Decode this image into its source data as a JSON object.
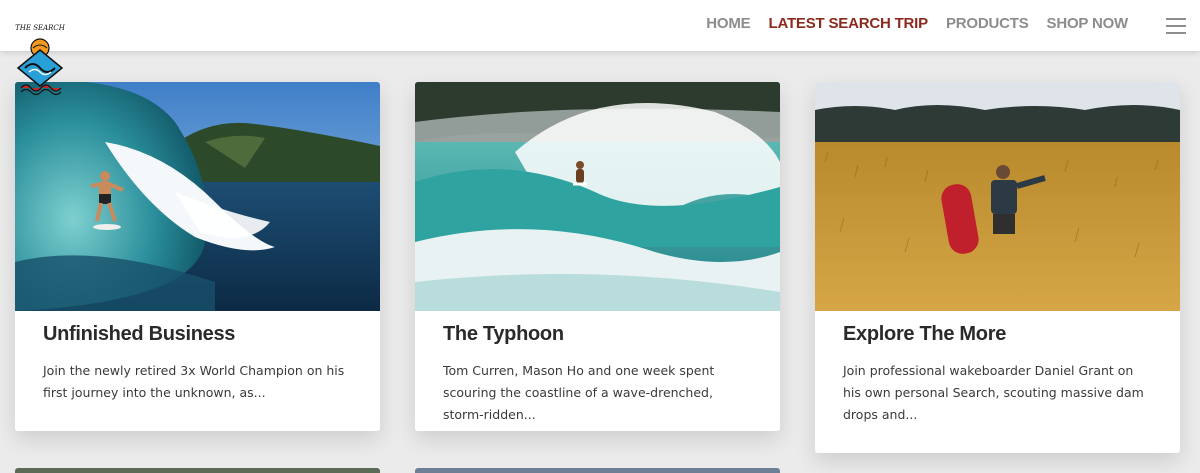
{
  "header": {
    "nav": [
      {
        "label": "HOME",
        "active": false
      },
      {
        "label": "LATEST SEARCH TRIP",
        "active": true
      },
      {
        "label": "PRODUCTS",
        "active": false
      },
      {
        "label": "SHOP NOW",
        "active": false
      }
    ],
    "menu_icon": "hamburger-icon",
    "logo_text": "THE SEARCH"
  },
  "colors": {
    "active_nav": "#8b2a1e",
    "nav": "#8d8d8d",
    "background": "#ebebeb"
  },
  "cards": [
    {
      "title": "Unfinished Business",
      "description": "Join the newly retired 3x World Champion on his first journey into the unknown, as...",
      "image": "surfer-barrel-wave-photo"
    },
    {
      "title": "The Typhoon",
      "description": "Tom Curren, Mason Ho and one week spent scouring the coastline of a wave-drenched, storm-ridden...",
      "image": "surfer-big-wave-photo"
    },
    {
      "title": "Explore The More",
      "description": "Join professional wakeboarder Daniel Grant on his own personal Search, scouting massive dam drops and...",
      "image": "wakeboarder-wheat-field-photo"
    }
  ]
}
